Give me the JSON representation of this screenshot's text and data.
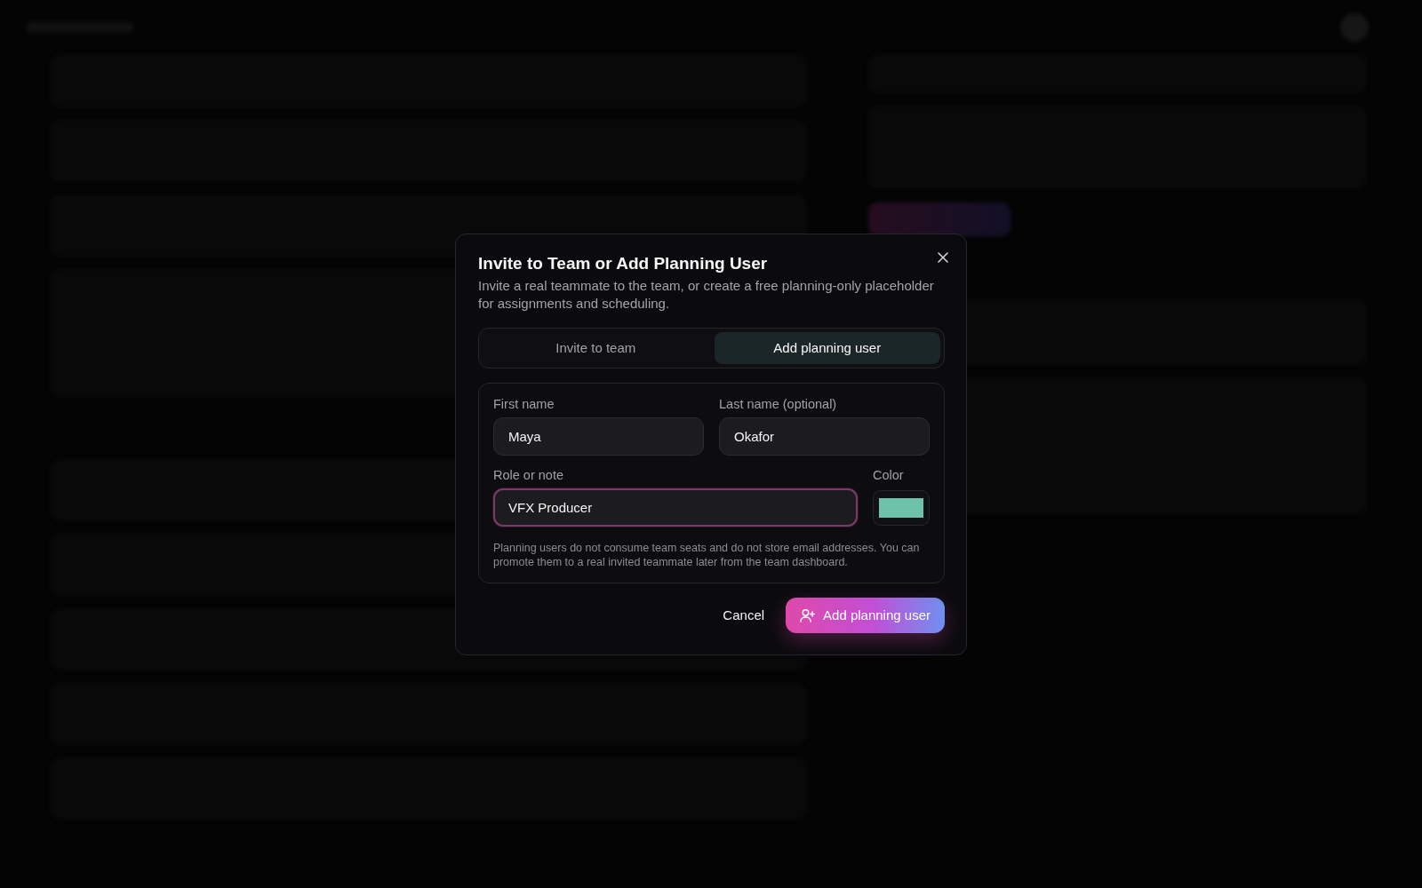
{
  "dialog": {
    "title": "Invite to Team or Add Planning User",
    "description": "Invite a real teammate to the team, or create a free planning-only placeholder for assignments and scheduling.",
    "tabs": [
      {
        "label": "Invite to team",
        "selected": false
      },
      {
        "label": "Add planning user",
        "selected": true
      }
    ],
    "form": {
      "rows": [
        [
          {
            "kind": "text",
            "label": "First name",
            "value": "Maya",
            "focused": false
          },
          {
            "kind": "text",
            "label": "Last name (optional)",
            "value": "Okafor",
            "focused": false
          }
        ],
        [
          {
            "kind": "text",
            "label": "Role or note",
            "value": "VFX Producer",
            "focused": true
          },
          {
            "kind": "color",
            "label": "Color",
            "color": "#6cc3aa"
          }
        ]
      ],
      "note": "Planning users do not consume team seats and do not store email addresses. You can promote them to a real invited teammate later from the team dashboard."
    },
    "buttons": [
      {
        "kind": "secondary",
        "label": "Cancel"
      },
      {
        "kind": "primary",
        "label": "Add planning user"
      }
    ]
  }
}
